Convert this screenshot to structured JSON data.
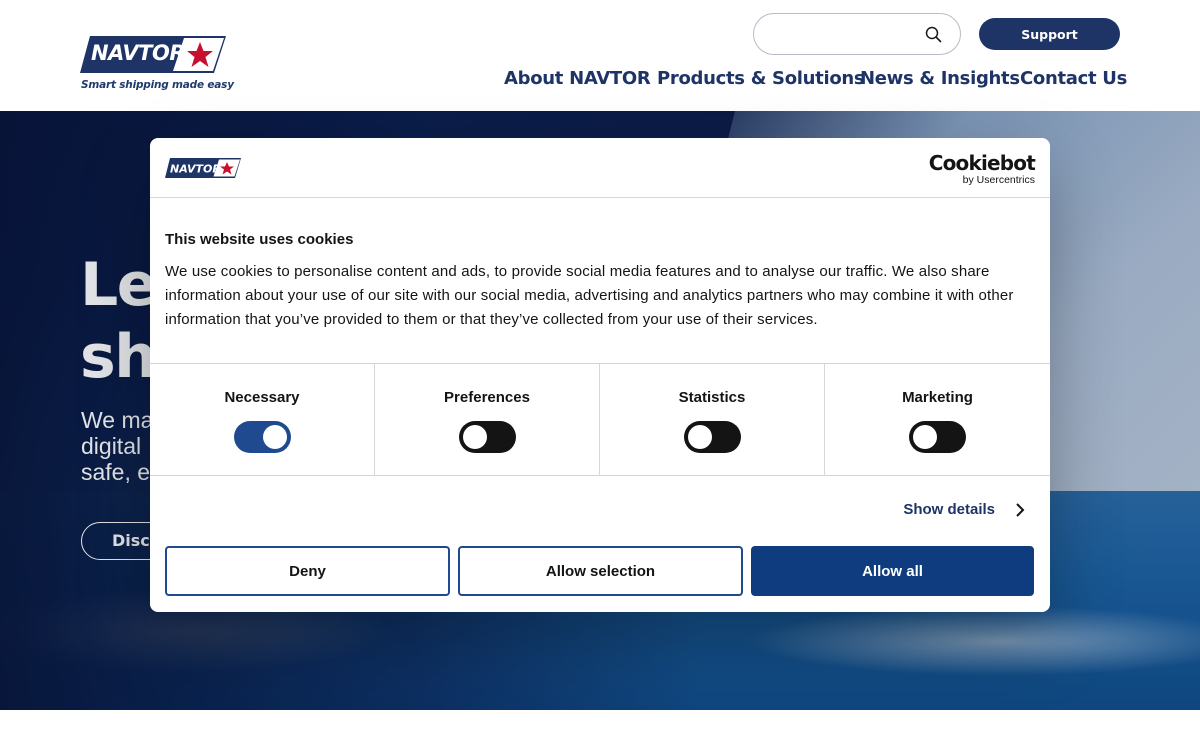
{
  "header": {
    "logo_text": "NAVTOR",
    "tagline": "Smart shipping made easy",
    "search": {
      "value": "",
      "placeholder": ""
    },
    "support_label": "Support",
    "nav": [
      "About NAVTOR",
      "Products & Solutions",
      "News & Insights",
      "Contact Us"
    ]
  },
  "hero": {
    "title": "Lea\nshi",
    "subtitle": "We ma\ndigital\nsafe, e",
    "cta_label": "Disco"
  },
  "cookie_dialog": {
    "logo_text": "NAVTOR",
    "brand_main": "Cookiebot",
    "brand_sub": "by Usercentrics",
    "title": "This website uses cookies",
    "body": "We use cookies to personalise content and ads, to provide social media features and to analyse our traffic. We also share information about your use of our site with our social media, advertising and analytics partners who may combine it with other information that you’ve provided to them or that they’ve collected from your use of their services.",
    "categories": [
      {
        "label": "Necessary",
        "enabled": true
      },
      {
        "label": "Preferences",
        "enabled": false
      },
      {
        "label": "Statistics",
        "enabled": false
      },
      {
        "label": "Marketing",
        "enabled": false
      }
    ],
    "show_details_label": "Show details",
    "buttons": {
      "deny": "Deny",
      "allow_selection": "Allow selection",
      "allow_all": "Allow all"
    }
  },
  "colors": {
    "brand_navy": "#1f3466",
    "accent_red": "#c8102e",
    "button_blue": "#0f3c7f"
  }
}
